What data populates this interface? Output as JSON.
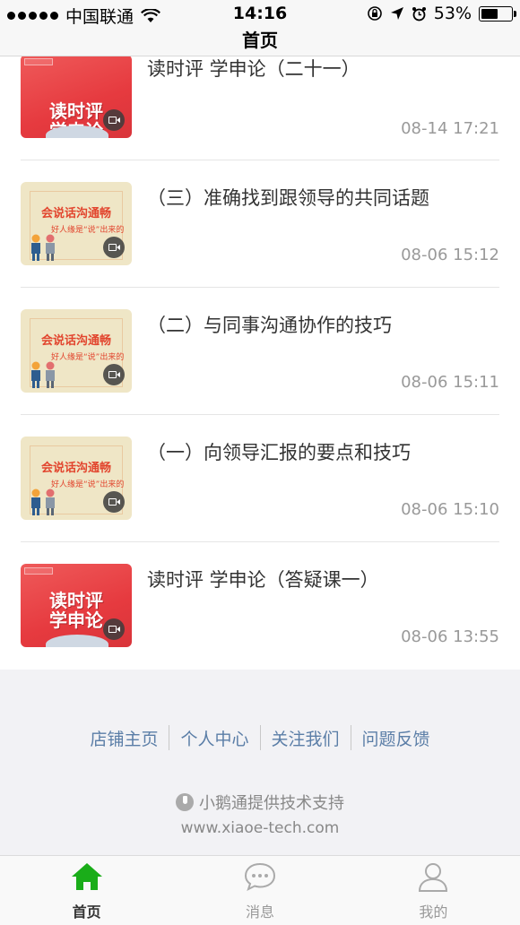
{
  "status_bar": {
    "carrier": "中国联通",
    "time": "14:16",
    "battery": "53%",
    "battery_level": 0.53
  },
  "nav": {
    "title": "首页"
  },
  "items": [
    {
      "title": "读时评 学申论（二十一）",
      "date": "08-14 17:21",
      "thumb": "red",
      "thumb_text": "读时评\n学申论",
      "icon": "play-video-icon"
    },
    {
      "title": "（三）准确找到跟领导的共同话题",
      "date": "08-06 15:12",
      "thumb": "beige",
      "thumb_text": "会说话沟通畅",
      "thumb_tag": "好人缘是“说”出来的",
      "icon": "play-video-icon"
    },
    {
      "title": "（二）与同事沟通协作的技巧",
      "date": "08-06 15:11",
      "thumb": "beige",
      "thumb_text": "会说话沟通畅",
      "thumb_tag": "好人缘是“说”出来的",
      "icon": "play-video-icon"
    },
    {
      "title": "（一）向领导汇报的要点和技巧",
      "date": "08-06 15:10",
      "thumb": "beige",
      "thumb_text": "会说话沟通畅",
      "thumb_tag": "好人缘是“说”出来的",
      "icon": "play-video-icon"
    },
    {
      "title": "读时评 学申论（答疑课一）",
      "date": "08-06 13:55",
      "thumb": "red",
      "thumb_text": "读时评\n学申论",
      "icon": "play-video-icon"
    }
  ],
  "footer": {
    "links": [
      "店铺主页",
      "个人中心",
      "关注我们",
      "问题反馈"
    ],
    "support": "小鹅通提供技术支持",
    "url": "www.xiaoe-tech.com"
  },
  "tabbar": {
    "tabs": [
      {
        "label": "首页",
        "icon": "home-icon",
        "active": true
      },
      {
        "label": "消息",
        "icon": "chat-bubble-icon",
        "active": false
      },
      {
        "label": "我的",
        "icon": "user-icon",
        "active": false
      }
    ]
  },
  "colors": {
    "accent": "#1aad19",
    "link": "#5b7ea7",
    "muted": "#999999"
  }
}
